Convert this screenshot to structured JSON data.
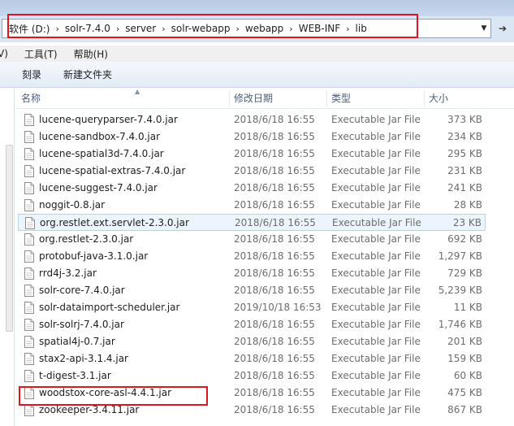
{
  "address_bar": {
    "crumbs": [
      "软件 (D:)",
      "solr-7.4.0",
      "server",
      "solr-webapp",
      "webapp",
      "WEB-INF",
      "lib"
    ],
    "separator": "›",
    "dropdown_icon": "chevron-down-icon",
    "refresh_icon": "refresh-arrow-icon"
  },
  "menu": {
    "items": [
      "V)",
      "工具(T)",
      "帮助(H)"
    ]
  },
  "toolbar": {
    "burn_label": "刻录",
    "new_folder_label": "新建文件夹"
  },
  "columns": {
    "name": "名称",
    "date": "修改日期",
    "type": "类型",
    "size": "大小"
  },
  "files": [
    {
      "name": "lucene-queryparser-7.4.0.jar",
      "date": "2018/6/18 16:55",
      "type": "Executable Jar File",
      "size": "373 KB"
    },
    {
      "name": "lucene-sandbox-7.4.0.jar",
      "date": "2018/6/18 16:55",
      "type": "Executable Jar File",
      "size": "234 KB"
    },
    {
      "name": "lucene-spatial3d-7.4.0.jar",
      "date": "2018/6/18 16:55",
      "type": "Executable Jar File",
      "size": "295 KB"
    },
    {
      "name": "lucene-spatial-extras-7.4.0.jar",
      "date": "2018/6/18 16:55",
      "type": "Executable Jar File",
      "size": "231 KB"
    },
    {
      "name": "lucene-suggest-7.4.0.jar",
      "date": "2018/6/18 16:55",
      "type": "Executable Jar File",
      "size": "241 KB"
    },
    {
      "name": "noggit-0.8.jar",
      "date": "2018/6/18 16:55",
      "type": "Executable Jar File",
      "size": "28 KB"
    },
    {
      "name": "org.restlet.ext.servlet-2.3.0.jar",
      "date": "2018/6/18 16:55",
      "type": "Executable Jar File",
      "size": "23 KB"
    },
    {
      "name": "org.restlet-2.3.0.jar",
      "date": "2018/6/18 16:55",
      "type": "Executable Jar File",
      "size": "692 KB"
    },
    {
      "name": "protobuf-java-3.1.0.jar",
      "date": "2018/6/18 16:55",
      "type": "Executable Jar File",
      "size": "1,297 KB"
    },
    {
      "name": "rrd4j-3.2.jar",
      "date": "2018/6/18 16:55",
      "type": "Executable Jar File",
      "size": "729 KB"
    },
    {
      "name": "solr-core-7.4.0.jar",
      "date": "2018/6/18 16:55",
      "type": "Executable Jar File",
      "size": "5,239 KB"
    },
    {
      "name": "solr-dataimport-scheduler.jar",
      "date": "2019/10/18 16:53",
      "type": "Executable Jar File",
      "size": "11 KB"
    },
    {
      "name": "solr-solrj-7.4.0.jar",
      "date": "2018/6/18 16:55",
      "type": "Executable Jar File",
      "size": "1,746 KB"
    },
    {
      "name": "spatial4j-0.7.jar",
      "date": "2018/6/18 16:55",
      "type": "Executable Jar File",
      "size": "201 KB"
    },
    {
      "name": "stax2-api-3.1.4.jar",
      "date": "2018/6/18 16:55",
      "type": "Executable Jar File",
      "size": "159 KB"
    },
    {
      "name": "t-digest-3.1.jar",
      "date": "2018/6/18 16:55",
      "type": "Executable Jar File",
      "size": "60 KB"
    },
    {
      "name": "woodstox-core-asl-4.4.1.jar",
      "date": "2018/6/18 16:55",
      "type": "Executable Jar File",
      "size": "475 KB"
    },
    {
      "name": "zookeeper-3.4.11.jar",
      "date": "2018/6/18 16:55",
      "type": "Executable Jar File",
      "size": "867 KB"
    }
  ],
  "selected_index": 6,
  "highlighted_index": 11,
  "file_icon": "jar-file-icon",
  "colors": {
    "highlight_box": "#e0141c",
    "selection_bg": "#ecf4fd",
    "selection_border": "#b7d3f0"
  }
}
